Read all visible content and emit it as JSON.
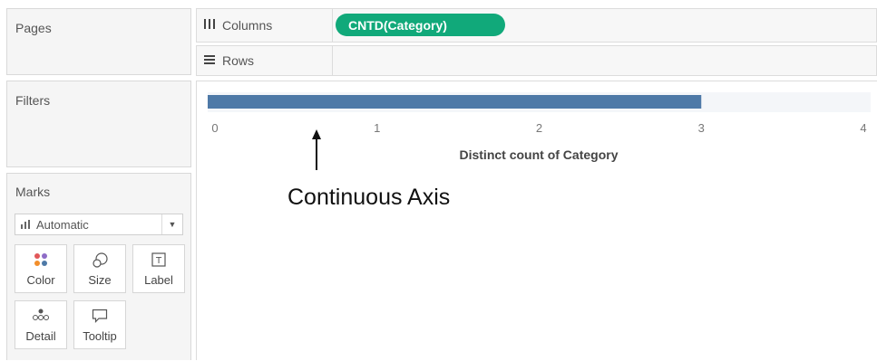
{
  "pages_card": {
    "title": "Pages"
  },
  "filters_card": {
    "title": "Filters"
  },
  "marks_card": {
    "title": "Marks",
    "mark_type": "Automatic",
    "buttons": [
      {
        "label": "Color",
        "icon": "color-dots-icon"
      },
      {
        "label": "Size",
        "icon": "size-icon"
      },
      {
        "label": "Label",
        "icon": "label-icon"
      },
      {
        "label": "Detail",
        "icon": "detail-icon"
      },
      {
        "label": "Tooltip",
        "icon": "tooltip-icon"
      }
    ]
  },
  "shelves": {
    "columns": {
      "label": "Columns",
      "pill": "CNTD(Category)"
    },
    "rows": {
      "label": "Rows"
    }
  },
  "colors": {
    "pill": "#11a97a",
    "bar": "#4e79a7"
  },
  "chart_data": {
    "type": "bar",
    "orientation": "horizontal",
    "values": [
      3
    ],
    "xlim": [
      0,
      4
    ],
    "ticks": [
      "0",
      "1",
      "2",
      "3",
      "4"
    ],
    "xlabel": "Distinct count of Category",
    "annotation": "Continuous Axis"
  }
}
